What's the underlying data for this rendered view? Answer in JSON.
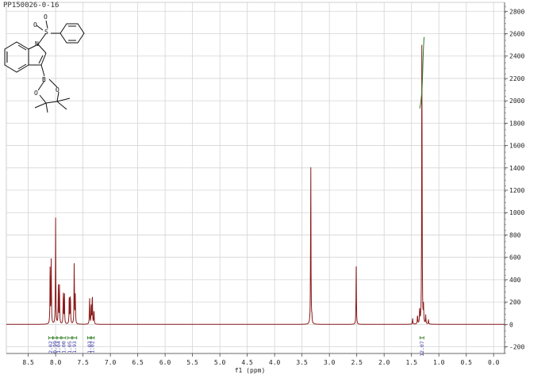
{
  "sample_id": "PP150026-0-16",
  "chart_data": {
    "type": "line",
    "title": "",
    "xlabel": "f1 (ppm)",
    "ylabel": "",
    "xlim": [
      8.9,
      -0.2
    ],
    "x_reversed": true,
    "ylim": [
      -260,
      2880
    ],
    "grid": true,
    "x_ticks": [
      8.5,
      8.0,
      7.5,
      7.0,
      6.5,
      6.0,
      5.5,
      5.0,
      4.5,
      4.0,
      3.5,
      3.0,
      2.5,
      2.0,
      1.5,
      1.0,
      0.5,
      0.0
    ],
    "x_tick_labels": [
      "8.5",
      "8.0",
      "7.5",
      "7.0",
      "6.5",
      "6.0",
      "5.5",
      "5.0",
      "4.5",
      "4.0",
      "3.5",
      "3.0",
      "2.5",
      "2.0",
      "1.5",
      "1.0",
      "0.5",
      "0.0"
    ],
    "y_ticks": [
      -200,
      0,
      200,
      400,
      600,
      800,
      1000,
      1200,
      1400,
      1600,
      1800,
      2000,
      2200,
      2400,
      2600,
      2800
    ],
    "y_tick_labels": [
      "-200",
      "0",
      "200",
      "400",
      "600",
      "800",
      "1000",
      "1200",
      "1400",
      "1600",
      "1800",
      "2000",
      "2200",
      "2400",
      "2600",
      "2800"
    ],
    "series_color": "#8b1a1a",
    "peaks": [
      {
        "ppm": 8.1,
        "height": 540
      },
      {
        "ppm": 8.08,
        "height": 600
      },
      {
        "ppm": 8.0,
        "height": 950
      },
      {
        "ppm": 7.95,
        "height": 340
      },
      {
        "ppm": 7.93,
        "height": 350
      },
      {
        "ppm": 7.86,
        "height": 300
      },
      {
        "ppm": 7.84,
        "height": 310
      },
      {
        "ppm": 7.75,
        "height": 310
      },
      {
        "ppm": 7.73,
        "height": 300
      },
      {
        "ppm": 7.66,
        "height": 600
      },
      {
        "ppm": 7.64,
        "height": 270
      },
      {
        "ppm": 7.38,
        "height": 270
      },
      {
        "ppm": 7.35,
        "height": 200
      },
      {
        "ppm": 7.33,
        "height": 310
      },
      {
        "ppm": 7.3,
        "height": 150
      },
      {
        "ppm": 3.34,
        "height": 1510
      },
      {
        "ppm": 3.32,
        "height": 60
      },
      {
        "ppm": 2.51,
        "height": 520
      },
      {
        "ppm": 1.48,
        "height": 60
      },
      {
        "ppm": 1.39,
        "height": 90
      },
      {
        "ppm": 1.35,
        "height": 150
      },
      {
        "ppm": 1.31,
        "height": 2900
      },
      {
        "ppm": 1.28,
        "height": 160
      },
      {
        "ppm": 1.24,
        "height": 80
      },
      {
        "ppm": 1.19,
        "height": 40
      }
    ],
    "integral_curve": {
      "start_ppm": 1.35,
      "end_ppm": 1.27,
      "y_start": 1930,
      "y_end": 2570,
      "color": "#2a7a1e"
    },
    "integrals": [
      {
        "ppm": 8.09,
        "label": "2.02"
      },
      {
        "ppm": 8.01,
        "label": "0.99"
      },
      {
        "ppm": 7.94,
        "label": "1.04"
      },
      {
        "ppm": 7.85,
        "label": "1.00"
      },
      {
        "ppm": 7.74,
        "label": "1.05"
      },
      {
        "ppm": 7.65,
        "label": "1.93"
      },
      {
        "ppm": 7.38,
        "label": "1.03"
      },
      {
        "ppm": 7.33,
        "label": "1.02"
      },
      {
        "ppm": 1.31,
        "label": "12.07"
      }
    ],
    "integral_color": "#2a7a1e",
    "integral_label_color": "#3a3aa0"
  },
  "molecule": {
    "atoms": [
      "O",
      "S",
      "O",
      "N",
      "B",
      "O",
      "O"
    ]
  }
}
